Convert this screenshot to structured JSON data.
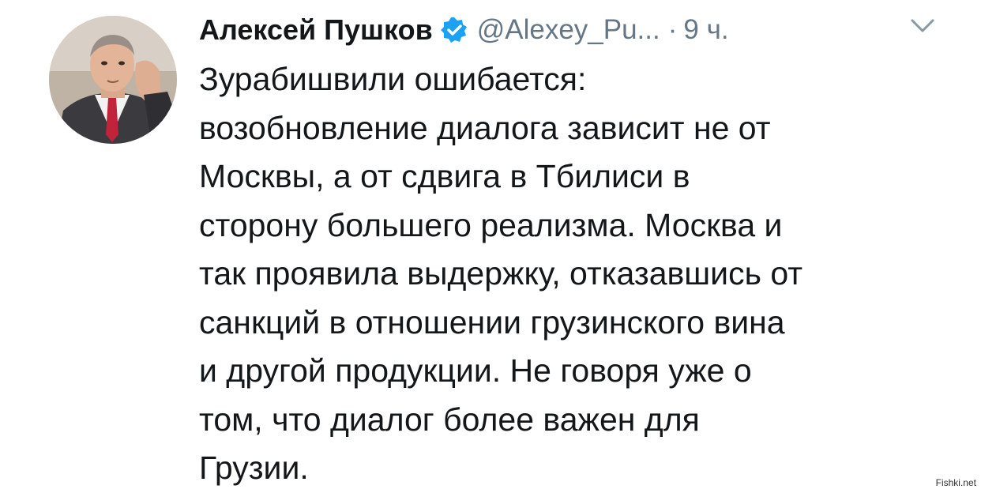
{
  "tweet": {
    "author_name": "Алексей Пушков",
    "handle": "@Alexey_Pu...",
    "separator": "·",
    "time": "9 ч.",
    "verified": true,
    "lines": [
      "Зурабишвили ошибается:",
      "возобновление диалога зависит не от",
      "Москвы, а от сдвига в Тбилиси в",
      "сторону большего реализма. Москва и",
      "так проявила выдержку, отказавшись от",
      "санкций в отношении грузинского вина",
      "и другой продукции. Не говоря уже о",
      "том, что диалог более важен для",
      "Грузии."
    ]
  },
  "watermark": "Fishki.net",
  "icons": {
    "verified": "verified-badge-icon",
    "menu": "chevron-down-icon"
  },
  "colors": {
    "text": "#14171a",
    "secondary": "#657786",
    "verified_blue": "#1da1f2"
  }
}
